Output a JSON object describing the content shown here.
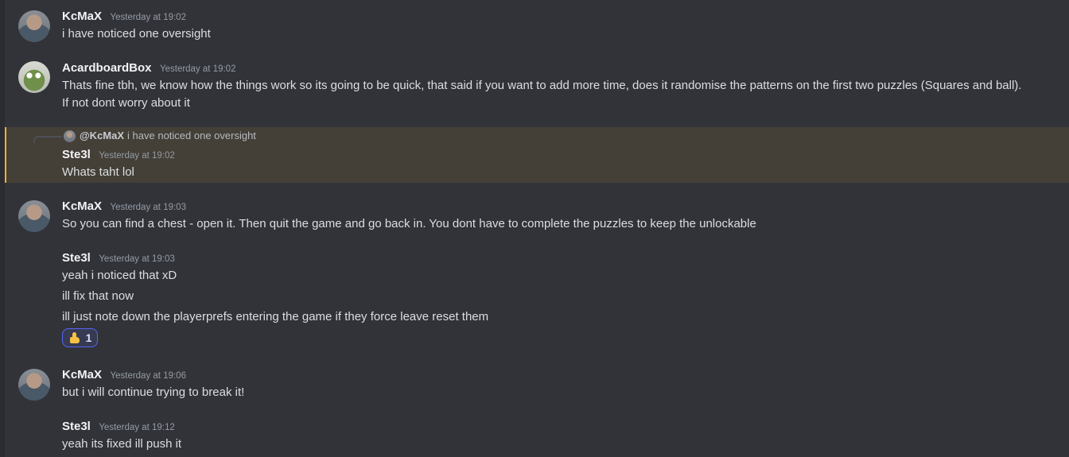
{
  "messages": [
    {
      "author": "KcMaX",
      "timestamp": "Yesterday at 19:02",
      "lines": [
        "i have noticed one oversight"
      ]
    },
    {
      "author": "AcardboardBox",
      "timestamp": "Yesterday at 19:02",
      "lines": [
        "Thats fine tbh, we know how the things work so its going to be quick, that said if you want to add more time, does it randomise the patterns on the first two puzzles (Squares and ball).",
        "If not dont worry about it"
      ]
    },
    {
      "reply_to": {
        "author": "@KcMaX",
        "text": "i have noticed one oversight"
      },
      "author": "Ste3l",
      "timestamp": "Yesterday at 19:02",
      "lines": [
        "Whats taht lol"
      ]
    },
    {
      "author": "KcMaX",
      "timestamp": "Yesterday at 19:03",
      "lines": [
        "So you can find a chest - open it. Then quit the game and go back in. You dont have to complete the puzzles to keep the unlockable"
      ]
    },
    {
      "author": "Ste3l",
      "timestamp": "Yesterday at 19:03",
      "lines": [
        "yeah i noticed that xD",
        "ill fix that now",
        "ill just note down the playerprefs entering the game if they force leave reset them"
      ],
      "reaction": {
        "emoji": "thumbs-up-icon",
        "count": "1"
      }
    },
    {
      "author": "KcMaX",
      "timestamp": "Yesterday at 19:06",
      "lines": [
        "but i will continue trying to break it!"
      ]
    },
    {
      "author": "Ste3l",
      "timestamp": "Yesterday at 19:12",
      "lines": [
        "yeah its fixed ill push it"
      ]
    }
  ],
  "colors": {
    "background": "#323339",
    "highlight": "#443f37",
    "highlight_border": "#f0b232",
    "reaction_border": "#5865f2"
  }
}
